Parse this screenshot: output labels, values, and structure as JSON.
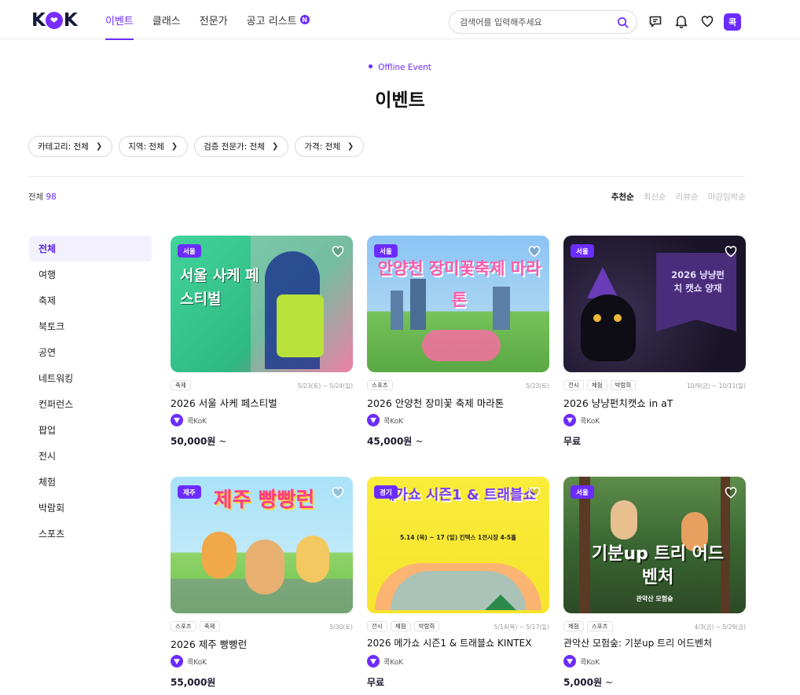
{
  "header": {
    "logo": {
      "k1": "K",
      "k2": "K"
    },
    "nav": [
      {
        "label": "이벤트",
        "active": true
      },
      {
        "label": "클래스",
        "active": false
      },
      {
        "label": "전문가",
        "active": false
      },
      {
        "label": "공고 리스트",
        "active": false,
        "badge": "N"
      }
    ],
    "search_placeholder": "검색어를 입력해주세요",
    "kok_button": "콕"
  },
  "page": {
    "eyebrow": "Offline Event",
    "title": "이벤트"
  },
  "filters": [
    "카테고리: 전체",
    "지역: 전체",
    "검증 전문가: 전체",
    "가격: 전체"
  ],
  "results": {
    "label": "전체",
    "count": "98"
  },
  "sorts": [
    {
      "label": "추천순",
      "active": true
    },
    {
      "label": "최신순",
      "active": false
    },
    {
      "label": "리뷰순",
      "active": false
    },
    {
      "label": "마감임박순",
      "active": false
    }
  ],
  "sidebar": [
    "전체",
    "여행",
    "축제",
    "북토크",
    "공연",
    "네트워킹",
    "컨퍼런스",
    "팝업",
    "전시",
    "체험",
    "박람회",
    "스포츠"
  ],
  "cards": [
    {
      "region": "서울",
      "tags": [
        "축제"
      ],
      "date": "5/23(토) ~ 5/24(일)",
      "title": "2026 서울 사케 페스티벌",
      "host": "콕KoK",
      "price": "50,000원",
      "price_suffix": "~",
      "colors": {
        "bg": "#35c98a",
        "accent": "#c7e84a"
      },
      "thumb_text": "서울 사케 페스티벌"
    },
    {
      "region": "서울",
      "tags": [
        "스포츠"
      ],
      "date": "5/23(토)",
      "title": "2026 안양천 장미꽃 축제 마라톤",
      "host": "콕KoK",
      "price": "45,000원",
      "price_suffix": "~",
      "colors": {
        "bg": "#7fb8f0",
        "accent": "#c9f04a"
      },
      "thumb_text": "안양천 장미꽃축제 마라톤"
    },
    {
      "region": "서울",
      "tags": [
        "전시",
        "체험",
        "박람회"
      ],
      "date": "10/9(금) ~ 10/11(일)",
      "title": "2026 냥냥펀치캣쇼 in aT",
      "host": "콕KoK",
      "price": "무료",
      "price_suffix": "",
      "colors": {
        "bg": "#241b3a",
        "accent": "#5a3a8e"
      },
      "thumb_text": "2026 냥냥펀치 캣쇼 양재"
    },
    {
      "region": "제주",
      "tags": [
        "스포츠",
        "축제"
      ],
      "date": "5/30(토)",
      "title": "2026 제주 빵빵런",
      "host": "콕KoK",
      "price": "55,000원",
      "price_suffix": "",
      "colors": {
        "bg": "#9fdcf5",
        "accent": "#f58a2c"
      },
      "thumb_text": "제주 빵빵런"
    },
    {
      "region": "경기",
      "tags": [
        "전시",
        "체험",
        "박람회"
      ],
      "date": "5/14(목) ~ 5/17(일)",
      "title": "2026 메가쇼 시즌1 & 트래블쇼 KINTEX",
      "host": "콕KoK",
      "price": "무료",
      "price_suffix": "",
      "colors": {
        "bg": "#f7ea3a",
        "accent": "#7a3cf0"
      },
      "thumb_text": "메가쇼 시즌1 & 트래블쇼",
      "thumb_sub": "5.14 (목) ~ 17 (일) 킨텍스 1전시장 4-5홀"
    },
    {
      "region": "서울",
      "tags": [
        "체험",
        "스포츠"
      ],
      "date": "4/3(금) ~ 5/29(금)",
      "title": "관악산 모험숲: 기분up 트리 어드벤처",
      "host": "콕KoK",
      "price": "5,000원",
      "price_suffix": "~",
      "colors": {
        "bg": "#3c6b3a",
        "accent": "#ffffff"
      },
      "thumb_text": "기분up 트리 어드벤처",
      "thumb_sub": "관악산 모험숲"
    }
  ]
}
